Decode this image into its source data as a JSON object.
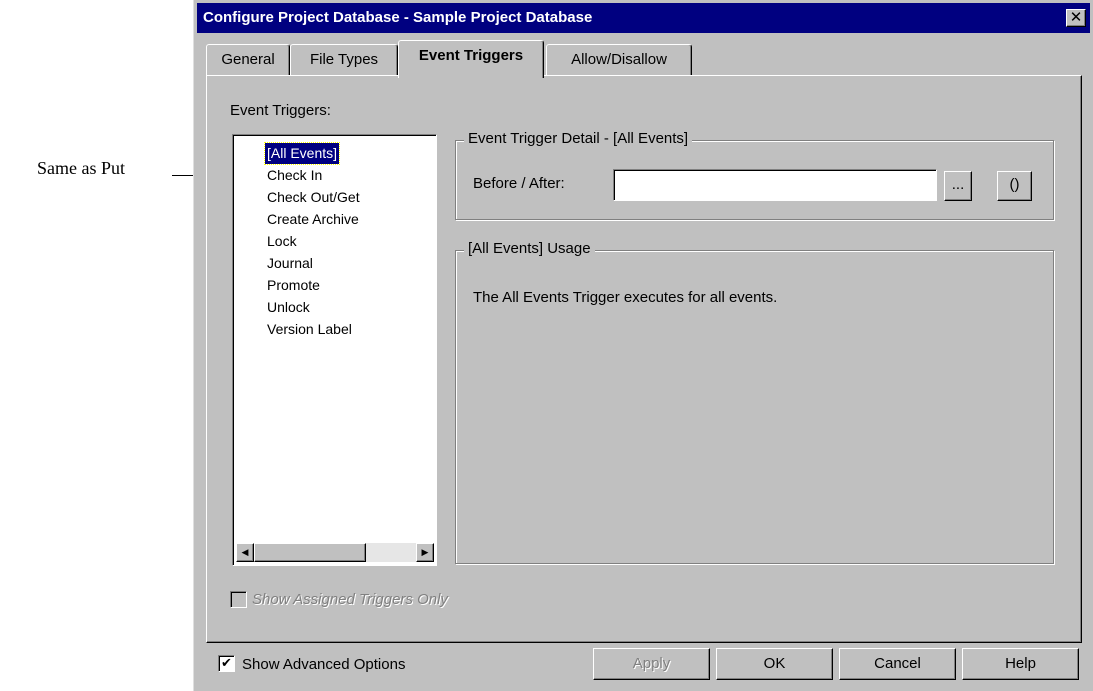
{
  "annotation": {
    "label": "Same as Put"
  },
  "dialog": {
    "title": "Configure Project Database - Sample Project Database",
    "close_glyph": "✕"
  },
  "tabs": [
    {
      "label": "General"
    },
    {
      "label": "File Types"
    },
    {
      "label": "Event Triggers",
      "active": true
    },
    {
      "label": "Allow/Disallow"
    }
  ],
  "event_triggers": {
    "label": "Event Triggers:",
    "items": [
      {
        "label": "[All Events]",
        "selected": true
      },
      {
        "label": "Check In"
      },
      {
        "label": "Check Out/Get"
      },
      {
        "label": "Create Archive"
      },
      {
        "label": "Lock"
      },
      {
        "label": "Journal"
      },
      {
        "label": "Promote"
      },
      {
        "label": "Unlock"
      },
      {
        "label": "Version Label"
      }
    ]
  },
  "detail": {
    "legend": "Event Trigger Detail - [All Events]",
    "before_after_label": "Before / After:",
    "before_after_value": "",
    "browse_label": "...",
    "params_label": "()"
  },
  "usage": {
    "legend": "[All Events]  Usage",
    "text": "The All Events Trigger executes for all events."
  },
  "show_assigned": {
    "label": "Show Assigned Triggers Only",
    "checked": false,
    "disabled": true
  },
  "show_advanced": {
    "label": "Show Advanced Options",
    "checked": true,
    "check_glyph": "✔"
  },
  "buttons": {
    "apply": "Apply",
    "ok": "OK",
    "cancel": "Cancel",
    "help": "Help"
  },
  "scroll": {
    "left_glyph": "◀",
    "right_glyph": "▶"
  }
}
